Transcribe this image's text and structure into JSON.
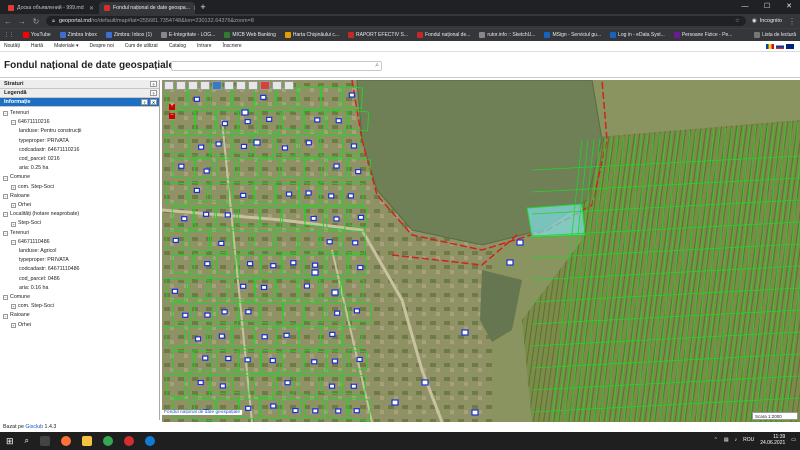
{
  "browser": {
    "tabs": [
      {
        "title": "Доска объявлений - 999.md",
        "active": false,
        "fav_color": "#e53935"
      },
      {
        "title": "Fondul național de date geospa...",
        "active": true,
        "fav_color": "#d32f2f"
      }
    ],
    "new_tab": "+",
    "window_controls": [
      "—",
      "☐",
      "✕"
    ],
    "url_host": "geoportal.md",
    "url_path": "/ro/default/map#lat=255681.7354748&lon=230132.64376&zoom=8",
    "profile_label": "Incognito",
    "bookmarks": [
      {
        "label": "YouTube",
        "color": "#ff0000"
      },
      {
        "label": "Zimbra Inbox",
        "color": "#3b6fd0"
      },
      {
        "label": "Zimbra: Inbox (1)",
        "color": "#3b6fd0"
      },
      {
        "label": "E-Integritate - LOG...",
        "color": "#888"
      },
      {
        "label": "MICB Web Banking",
        "color": "#2e7d32"
      },
      {
        "label": "Harta Chişinăului c...",
        "color": "#e0a000"
      },
      {
        "label": "RAPORT EFECTIV S...",
        "color": "#c62828"
      },
      {
        "label": "Fondul național de...",
        "color": "#c62828"
      },
      {
        "label": "rutor.info :: SketchU...",
        "color": "#888"
      },
      {
        "label": "MSign - Serviciul gu...",
        "color": "#1565c0"
      },
      {
        "label": "Log in - eData Syst...",
        "color": "#1565c0"
      },
      {
        "label": "Persoane Fizice - Pe...",
        "color": "#6a1b9a"
      }
    ],
    "reading_list": "Lista de lectură"
  },
  "site_menu": {
    "items": [
      "Noutăți",
      "Hartă",
      "Materiale ▾",
      "Despre noi",
      "Cum de utilizat",
      "Catalog",
      "Intrare",
      "Înscriere"
    ]
  },
  "header": {
    "title": "Fondul național de date geospațiale",
    "search_placeholder": ""
  },
  "sidebar": {
    "panels": [
      {
        "label": "Straturi",
        "active": false
      },
      {
        "label": "Legendă",
        "active": false
      },
      {
        "label": "Informație",
        "active": true
      }
    ],
    "tree": [
      {
        "level": 1,
        "toggle": "−",
        "text": "Terenuri"
      },
      {
        "level": 2,
        "toggle": "−",
        "text": "64671110216"
      },
      {
        "level": 3,
        "toggle": "",
        "text": "landuse: Pentru construcții"
      },
      {
        "level": 3,
        "toggle": "",
        "text": "typeproper: PRIVATA"
      },
      {
        "level": 3,
        "toggle": "",
        "text": "codcadastr: 64671110216"
      },
      {
        "level": 3,
        "toggle": "",
        "text": "cod_parcel: 0216"
      },
      {
        "level": 3,
        "toggle": "",
        "text": "aria: 0.25 ha"
      },
      {
        "level": 1,
        "toggle": "−",
        "text": "Comune"
      },
      {
        "level": 2,
        "toggle": "+",
        "text": "com. Step-Soci"
      },
      {
        "level": 1,
        "toggle": "−",
        "text": "Raioane"
      },
      {
        "level": 2,
        "toggle": "+",
        "text": "Orhei"
      },
      {
        "level": 1,
        "toggle": "−",
        "text": "Localități (hotare neaprobate)"
      },
      {
        "level": 2,
        "toggle": "+",
        "text": "Step-Soci"
      },
      {
        "level": 1,
        "toggle": "−",
        "text": "Terenuri"
      },
      {
        "level": 2,
        "toggle": "−",
        "text": "64671110486"
      },
      {
        "level": 3,
        "toggle": "",
        "text": "landuse: Agricol"
      },
      {
        "level": 3,
        "toggle": "",
        "text": "typeproper: PRIVATA"
      },
      {
        "level": 3,
        "toggle": "",
        "text": "codcadastr: 64671110486"
      },
      {
        "level": 3,
        "toggle": "",
        "text": "cod_parcel: 0486"
      },
      {
        "level": 3,
        "toggle": "",
        "text": "aria: 0.16 ha"
      },
      {
        "level": 1,
        "toggle": "−",
        "text": "Comune"
      },
      {
        "level": 2,
        "toggle": "+",
        "text": "com. Step-Soci"
      },
      {
        "level": 1,
        "toggle": "−",
        "text": "Raioane"
      },
      {
        "level": 2,
        "toggle": "+",
        "text": "Orhei"
      }
    ],
    "footer_prefix": "Bazat pe ",
    "footer_link": "Gisclub",
    "footer_version": " 1.4.3"
  },
  "map": {
    "footer_text": "Fondul național de date geospațiale",
    "scale_label": "Scara 1:2000",
    "zoom_in": "+",
    "zoom_out": "−",
    "colors": {
      "parcel": "#22d42a",
      "boundary": "#d42020",
      "water": "#6f7f56",
      "selection": "#7fe0e8"
    }
  },
  "taskbar": {
    "lang": "ROU",
    "time": "11:39",
    "date": "24.06.2021"
  }
}
